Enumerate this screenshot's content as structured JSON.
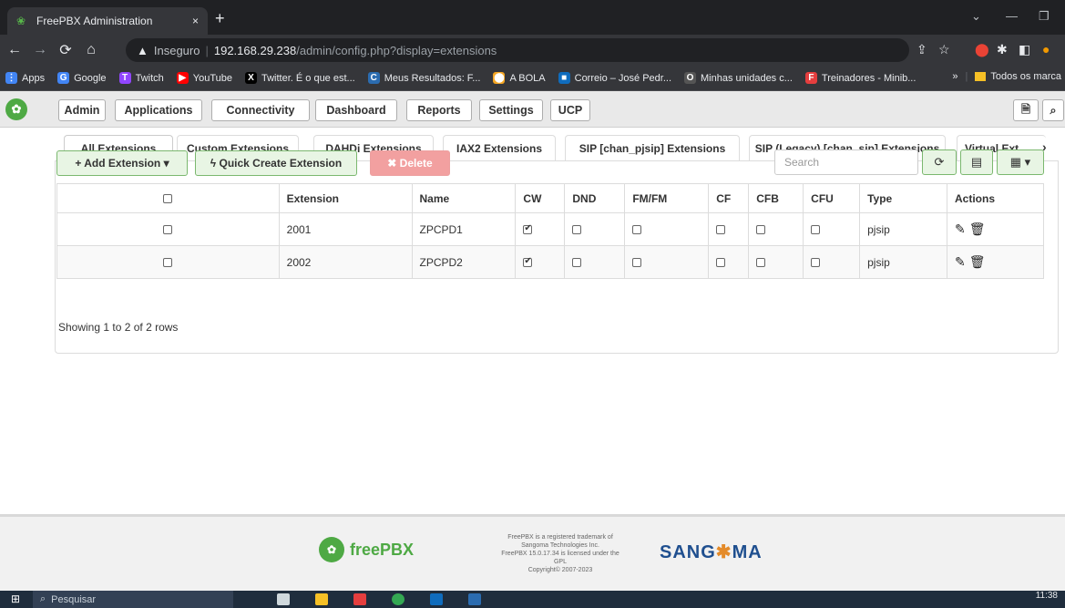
{
  "browser": {
    "tab_title": "FreePBX Administration",
    "tab_close": "×",
    "new_tab": "+",
    "security_label": "Inseguro",
    "url_host": "192.168.29.238",
    "url_path": "/admin/config.php?display=extensions",
    "bookmarks": [
      {
        "label": "Apps",
        "color": "#4285f4",
        "glyph": "⋮"
      },
      {
        "label": "Google",
        "color": "#4285f4",
        "glyph": "G"
      },
      {
        "label": "Twitch",
        "color": "#9146ff",
        "glyph": "T"
      },
      {
        "label": "YouTube",
        "color": "#ff0000",
        "glyph": "▶"
      },
      {
        "label": "Twitter. É o que est...",
        "color": "#000000",
        "glyph": "X"
      },
      {
        "label": "Meus Resultados: F...",
        "color": "#2b6cb0",
        "glyph": "C"
      },
      {
        "label": "A BOLA",
        "color": "#f5a623",
        "glyph": "⬤"
      },
      {
        "label": "Correio – José Pedr...",
        "color": "#0f6cbd",
        "glyph": "■"
      },
      {
        "label": "Minhas unidades c...",
        "color": "#555555",
        "glyph": "O"
      },
      {
        "label": "Treinadores - Minib...",
        "color": "#e53e3e",
        "glyph": "F"
      }
    ],
    "bookmarks_more": "»",
    "bookmarks_folder": "Todos os marca"
  },
  "menu": {
    "items": [
      "Admin",
      "Applications",
      "Connectivity",
      "Dashboard",
      "Reports",
      "Settings",
      "UCP"
    ]
  },
  "tabs": [
    "All Extensions",
    "Custom Extensions",
    "DAHDi Extensions",
    "IAX2 Extensions",
    "SIP [chan_pjsip] Extensions",
    "SIP (Legacy) [chan_sip] Extensions",
    "Virtual Ext"
  ],
  "toolbar": {
    "add_label": "+ Add Extension ▾",
    "quick_create_label": "ϟ Quick Create Extension",
    "delete_label": "✖ Delete",
    "search_placeholder": "Search",
    "refresh_icon": "⟳",
    "columns_icon": "▤",
    "grid_icon": "▦ ▾"
  },
  "table": {
    "columns": [
      "",
      "Extension",
      "Name",
      "CW",
      "DND",
      "FM/FM",
      "CF",
      "CFB",
      "CFU",
      "Type",
      "Actions"
    ],
    "rows": [
      {
        "extension": "2001",
        "name": "ZPCPD1",
        "cw": true,
        "dnd": false,
        "fmfm": false,
        "cf": false,
        "cfb": false,
        "cfu": false,
        "type": "pjsip"
      },
      {
        "extension": "2002",
        "name": "ZPCPD2",
        "cw": true,
        "dnd": false,
        "fmfm": false,
        "cf": false,
        "cfb": false,
        "cfu": false,
        "type": "pjsip"
      }
    ],
    "footer": "Showing 1 to 2 of 2 rows"
  },
  "footer": {
    "brand": "freePBX",
    "legal_lines": [
      "FreePBX is a registered trademark of",
      "Sangoma Technologies Inc.",
      "FreePBX 15.0.17.34 is licensed under the",
      "GPL",
      "Copyright© 2007-2023"
    ],
    "sangoma_a": "SANG",
    "sangoma_star": "✱",
    "sangoma_b": "MA"
  },
  "taskbar": {
    "search_placeholder": "Pesquisar",
    "time": "11:38"
  }
}
